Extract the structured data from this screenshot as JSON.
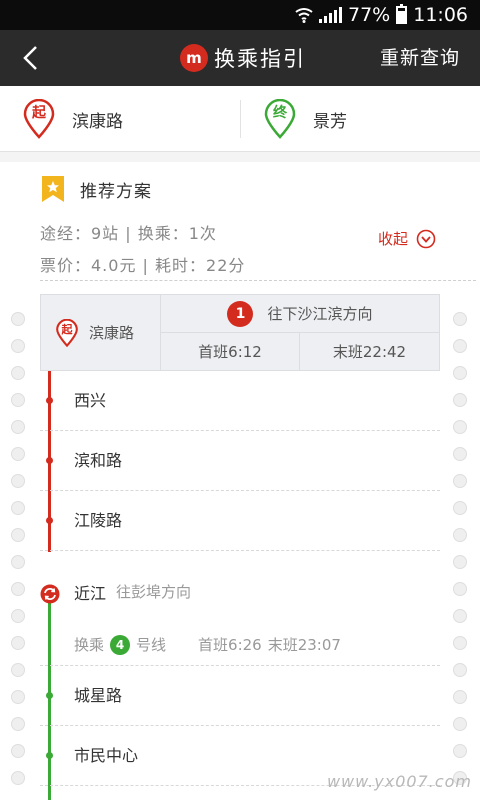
{
  "status_bar": {
    "battery": "77%",
    "time": "11:06"
  },
  "header": {
    "logo": "m",
    "title": "换乘指引",
    "requery": "重新查询"
  },
  "origin_dest": {
    "start_marker": "起",
    "start_name": "滨康路",
    "end_marker": "终",
    "end_name": "景芳"
  },
  "recommendation": {
    "title": "推荐方案",
    "summary_line1": "途经：9站 | 换乘：1次",
    "summary_line2": "票价：4.0元 | 耗时：22分",
    "collapse_label": "收起"
  },
  "board": {
    "marker": "起",
    "station": "滨康路",
    "line_number": "1",
    "direction": "往下沙江滨方向",
    "first_train": "首班6:12",
    "last_train": "末班22:42"
  },
  "stops_line1": [
    {
      "name": "西兴"
    },
    {
      "name": "滨和路"
    },
    {
      "name": "江陵路"
    }
  ],
  "transfer": {
    "station": "近江",
    "direction": "往彭埠方向",
    "prefix": "换乘",
    "line_number": "4",
    "line_suffix": "号线",
    "first_train": "首班6:26",
    "last_train": "末班23:07"
  },
  "stops_line4": [
    {
      "name": "城星路"
    },
    {
      "name": "市民中心"
    }
  ],
  "watermark": "www.yx007.com",
  "colors": {
    "line1": "#d42b1f",
    "line4": "#3aa935",
    "accent": "#d42b1f",
    "star": "#f3b51e"
  }
}
